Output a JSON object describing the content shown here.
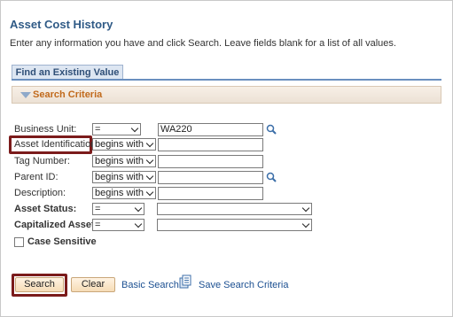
{
  "page": {
    "title": "Asset Cost History",
    "instructions": "Enter any information you have and click Search. Leave fields blank for a list of all values."
  },
  "tab": {
    "label": "Find an Existing Value"
  },
  "section": {
    "title": "Search Criteria"
  },
  "fields": {
    "business_unit": {
      "label": "Business Unit:",
      "operator": "=",
      "value": "WA220"
    },
    "asset_identification": {
      "label": "Asset Identification:",
      "operator": "begins with",
      "value": ""
    },
    "tag_number": {
      "label": "Tag Number:",
      "operator": "begins with",
      "value": ""
    },
    "parent_id": {
      "label": "Parent ID:",
      "operator": "begins with",
      "value": ""
    },
    "description": {
      "label": "Description:",
      "operator": "begins with",
      "value": ""
    },
    "asset_status": {
      "label": "Asset Status:",
      "operator": "=",
      "value": ""
    },
    "capitalized_asset": {
      "label": "Capitalized Asset:",
      "operator": "=",
      "value": ""
    }
  },
  "case_sensitive": {
    "label": "Case Sensitive",
    "checked": false
  },
  "buttons": {
    "search": "Search",
    "clear": "Clear",
    "basic_search": "Basic Search",
    "save_search": "Save Search Criteria"
  },
  "icons": {
    "lookup": "magnifier-icon",
    "save_criteria": "document-icon",
    "collapse": "triangle-down-icon"
  },
  "colors": {
    "title": "#2f5a86",
    "section_title": "#c16a1c",
    "link": "#1b4f91",
    "highlight": "#7b1b1b"
  }
}
